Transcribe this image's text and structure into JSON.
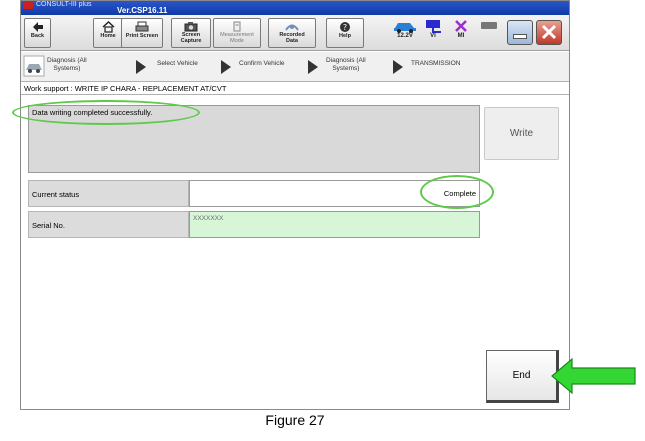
{
  "window": {
    "title_text": "CONSULT-III plus",
    "version": "Ver.CSP16.11"
  },
  "toolbar": {
    "back_label": "Back",
    "home_label": "Home",
    "print_label": "Print Screen",
    "capture_label_1": "Screen",
    "capture_label_2": "Capture",
    "measure_label_1": "Measurement",
    "measure_label_2": "Mode",
    "recorded_label_1": "Recorded",
    "recorded_label_2": "Data",
    "help_label": "Help",
    "battery_label": "12.2V",
    "vi_label": "VI",
    "mi_label": "MI"
  },
  "breadcrumb": {
    "items": [
      {
        "line1": "Diagnosis (All",
        "line2": "Systems)"
      },
      {
        "label": "Select Vehicle"
      },
      {
        "label": "Confirm Vehicle"
      },
      {
        "line1": "Diagnosis (All",
        "line2": "Systems)"
      },
      {
        "label": "TRANSMISSION"
      }
    ]
  },
  "work_support": {
    "label": "Work support : WRITE IP CHARA - REPLACEMENT AT/CVT"
  },
  "message": {
    "text": "Data writing completed successfully."
  },
  "buttons": {
    "write_label": "Write",
    "end_label": "End"
  },
  "rows": [
    {
      "label": "Current status",
      "value": "Complete"
    },
    {
      "label": "Serial No.",
      "value": "XXXXXXX"
    }
  ],
  "caption": "Figure 27",
  "colors": {
    "highlight": "#5ec94a",
    "arrow": "#33d633",
    "serial_bg": "#d7f5d7",
    "titlebar": "#1f4fc0"
  }
}
